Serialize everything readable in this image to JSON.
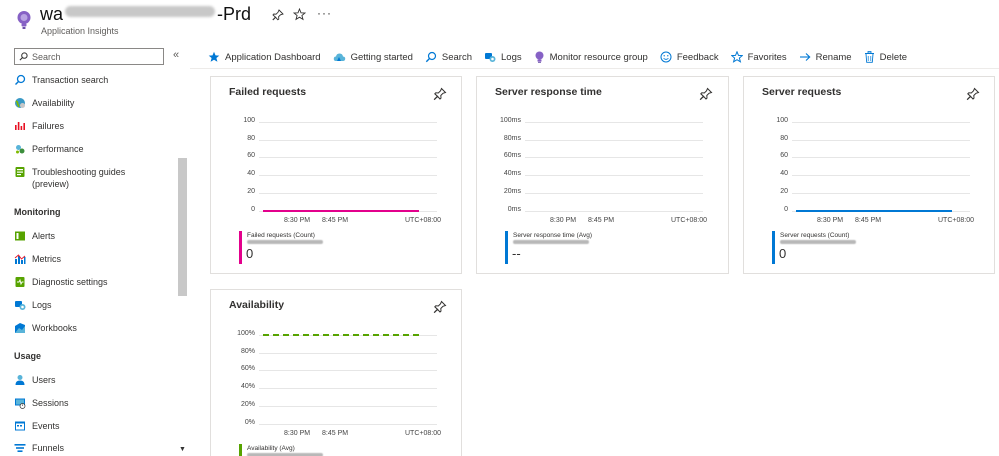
{
  "header": {
    "title_prefix": "wa",
    "title_suffix": "-Prd",
    "subtitle": "Application Insights",
    "pin_icon": "pin-icon",
    "favorite_icon": "star-icon",
    "more_label": "···"
  },
  "sidebar": {
    "search_placeholder": "Search",
    "collapse_label": "«",
    "items_top": [
      {
        "label": "Transaction search",
        "icon": "search-icon"
      },
      {
        "label": "Availability",
        "icon": "globe-icon"
      },
      {
        "label": "Failures",
        "icon": "failures-icon"
      },
      {
        "label": "Performance",
        "icon": "performance-icon"
      },
      {
        "label": "Troubleshooting guides (preview)",
        "icon": "guide-icon"
      }
    ],
    "section_monitoring": "Monitoring",
    "items_monitoring": [
      {
        "label": "Alerts",
        "icon": "alerts-icon"
      },
      {
        "label": "Metrics",
        "icon": "metrics-icon"
      },
      {
        "label": "Diagnostic settings",
        "icon": "diagnostic-icon"
      },
      {
        "label": "Logs",
        "icon": "logs-icon"
      },
      {
        "label": "Workbooks",
        "icon": "workbooks-icon"
      }
    ],
    "section_usage": "Usage",
    "items_usage": [
      {
        "label": "Users",
        "icon": "users-icon"
      },
      {
        "label": "Sessions",
        "icon": "sessions-icon"
      },
      {
        "label": "Events",
        "icon": "events-icon"
      },
      {
        "label": "Funnels",
        "icon": "funnels-icon"
      }
    ]
  },
  "toolbar": {
    "items": [
      {
        "label": "Application Dashboard",
        "icon": "star-filled-icon"
      },
      {
        "label": "Getting started",
        "icon": "cloud-icon"
      },
      {
        "label": "Search",
        "icon": "search-icon"
      },
      {
        "label": "Logs",
        "icon": "logs-icon"
      },
      {
        "label": "Monitor resource group",
        "icon": "bulb-icon"
      },
      {
        "label": "Feedback",
        "icon": "smiley-icon"
      },
      {
        "label": "Favorites",
        "icon": "star-outline-icon"
      },
      {
        "label": "Rename",
        "icon": "arrow-right-icon"
      },
      {
        "label": "Delete",
        "icon": "trash-icon"
      }
    ]
  },
  "tiles": {
    "failed": {
      "title": "Failed requests",
      "yticks": [
        "100",
        "80",
        "60",
        "40",
        "20",
        "0"
      ],
      "xticks": [
        "8:30 PM",
        "8:45 PM"
      ],
      "timezone": "UTC+08:00",
      "legend": "Failed requests (Count)",
      "value": "0",
      "color": "#e3008c"
    },
    "response": {
      "title": "Server response time",
      "yticks": [
        "100ms",
        "80ms",
        "60ms",
        "40ms",
        "20ms",
        "0ms"
      ],
      "xticks": [
        "8:30 PM",
        "8:45 PM"
      ],
      "timezone": "UTC+08:00",
      "legend": "Server response time (Avg)",
      "value": "--",
      "color": "#0078d4"
    },
    "requests": {
      "title": "Server requests",
      "yticks": [
        "100",
        "80",
        "60",
        "40",
        "20",
        "0"
      ],
      "xticks": [
        "8:30 PM",
        "8:45 PM"
      ],
      "timezone": "UTC+08:00",
      "legend": "Server requests (Count)",
      "value": "0",
      "color": "#0078d4"
    },
    "availability": {
      "title": "Availability",
      "yticks": [
        "100%",
        "80%",
        "60%",
        "40%",
        "20%",
        "0%"
      ],
      "xticks": [
        "8:30 PM",
        "8:45 PM"
      ],
      "timezone": "UTC+08:00",
      "legend": "Availability (Avg)",
      "color": "#57a300"
    }
  }
}
